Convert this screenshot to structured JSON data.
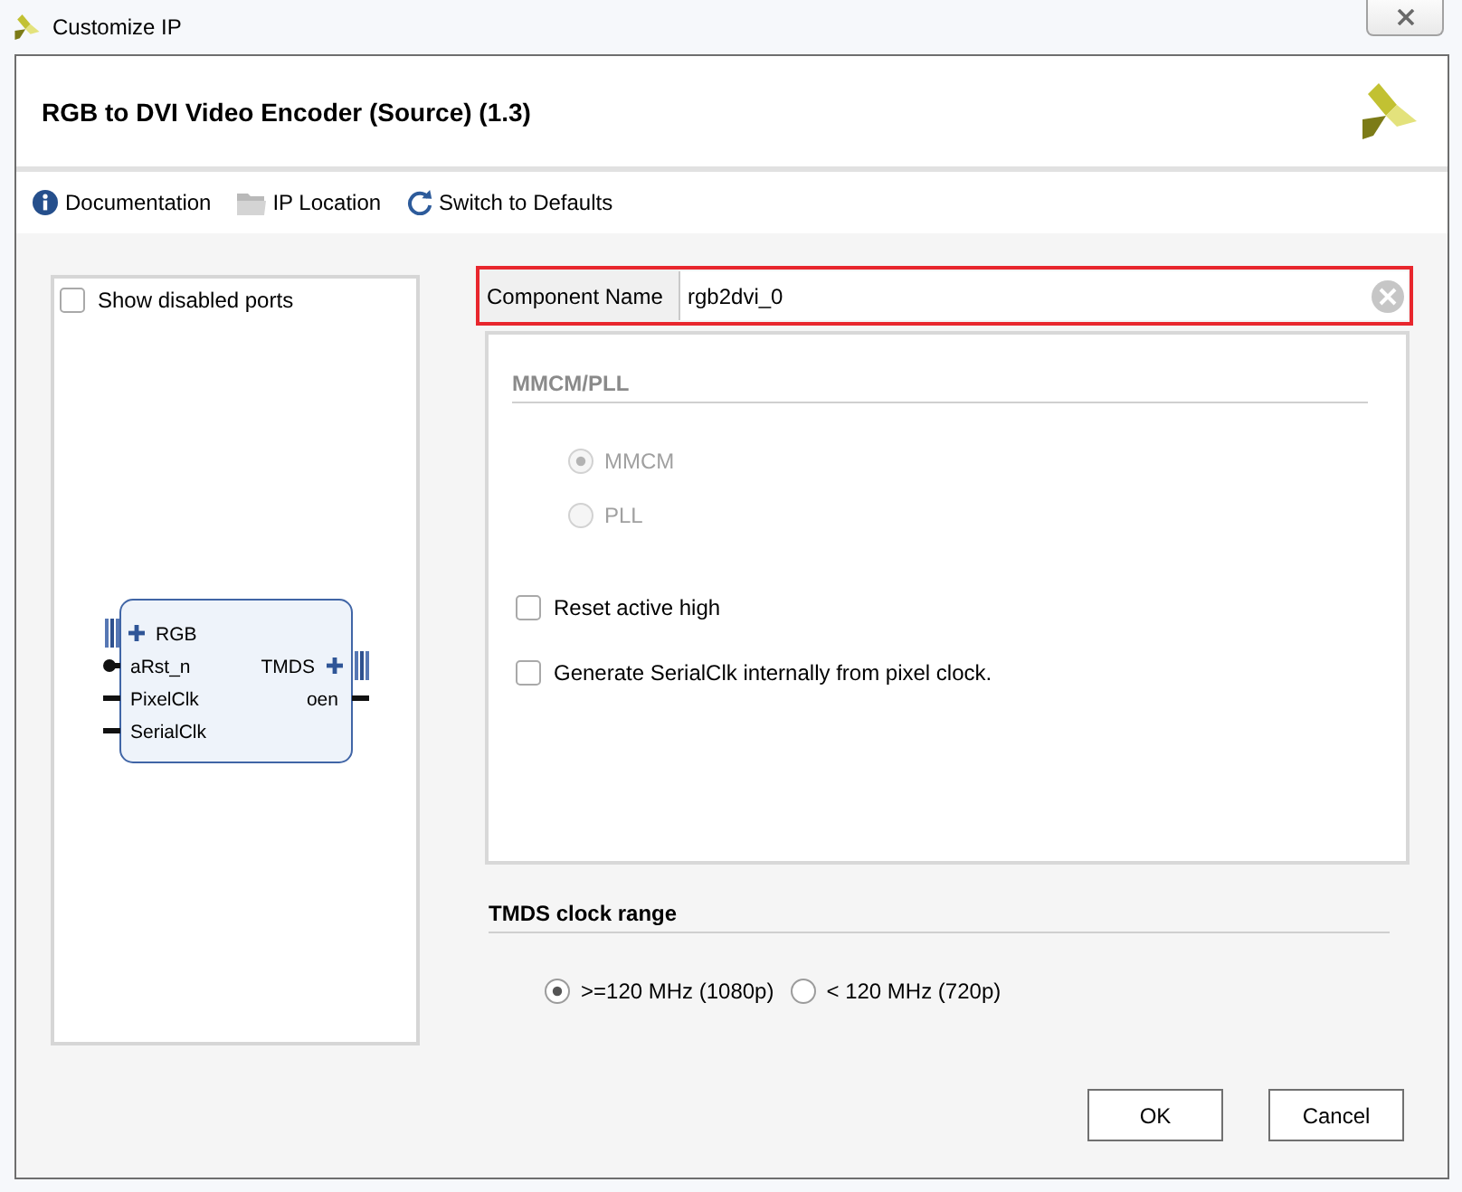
{
  "window": {
    "title": "Customize IP"
  },
  "header": {
    "title": "RGB to DVI Video Encoder (Source) (1.3)"
  },
  "toolbar": [
    {
      "label": "Documentation",
      "kind": "info"
    },
    {
      "label": "IP Location",
      "kind": "folder"
    },
    {
      "label": "Switch to Defaults",
      "kind": "reset"
    }
  ],
  "symbol_panel": {
    "show_disabled_ports": {
      "label": "Show disabled ports",
      "checked": false
    },
    "left_ports": [
      {
        "label": "RGB",
        "kind": "bus"
      },
      {
        "label": "aRst_n",
        "kind": "inverted"
      },
      {
        "label": "PixelClk",
        "kind": "wire"
      },
      {
        "label": "SerialClk",
        "kind": "wire"
      }
    ],
    "right_ports": [
      {
        "label": "TMDS",
        "kind": "bus"
      },
      {
        "label": "oen",
        "kind": "wire"
      }
    ]
  },
  "component_name": {
    "label": "Component Name",
    "value": "rgb2dvi_0",
    "highlighted": true
  },
  "mmcm_pll": {
    "title": "MMCM/PLL",
    "disabled": true,
    "options": [
      {
        "label": "MMCM",
        "selected": true
      },
      {
        "label": "PLL",
        "selected": false
      }
    ]
  },
  "checkboxes": [
    {
      "label": "Reset active high",
      "checked": false
    },
    {
      "label": "Generate SerialClk internally from pixel clock.",
      "checked": false
    }
  ],
  "tmds_clock_range": {
    "title": "TMDS clock range",
    "options": [
      {
        "label": ">=120 MHz (1080p)",
        "selected": true
      },
      {
        "label": "< 120 MHz (720p)",
        "selected": false
      }
    ]
  },
  "buttons": [
    {
      "label": "OK"
    },
    {
      "label": "Cancel"
    }
  ]
}
